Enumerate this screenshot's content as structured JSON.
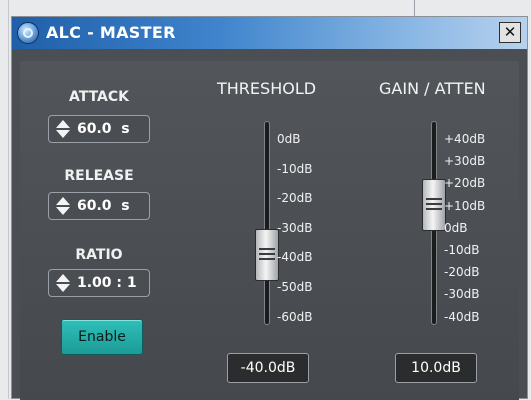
{
  "window": {
    "title": "ALC - MASTER",
    "close_glyph": "✕",
    "icon_name": "app-globe-icon"
  },
  "controls": {
    "attack": {
      "label": "ATTACK",
      "value": "60.0  s"
    },
    "release": {
      "label": "RELEASE",
      "value": "60.0  s"
    },
    "ratio": {
      "label": "RATIO",
      "value": "1.00 : 1"
    },
    "enable_label": "Enable"
  },
  "threshold": {
    "title": "THRESHOLD",
    "ticks": [
      "0dB",
      "-10dB",
      "-20dB",
      "-30dB",
      "-40dB",
      "-50dB",
      "-60dB"
    ],
    "readout": "-40.0dB",
    "level_db": -40
  },
  "gain": {
    "title": "GAIN / ATTEN",
    "ticks": [
      "+40dB",
      "+30dB",
      "+20dB",
      "+10dB",
      "0dB",
      "-10dB",
      "-20dB",
      "-30dB",
      "-40dB"
    ],
    "readout": "10.0dB",
    "level_db": 10
  },
  "colors": {
    "titlebar_start": "#1f5fa9",
    "panel": "#4b4f53",
    "enable_button": "#2fbfb9"
  }
}
